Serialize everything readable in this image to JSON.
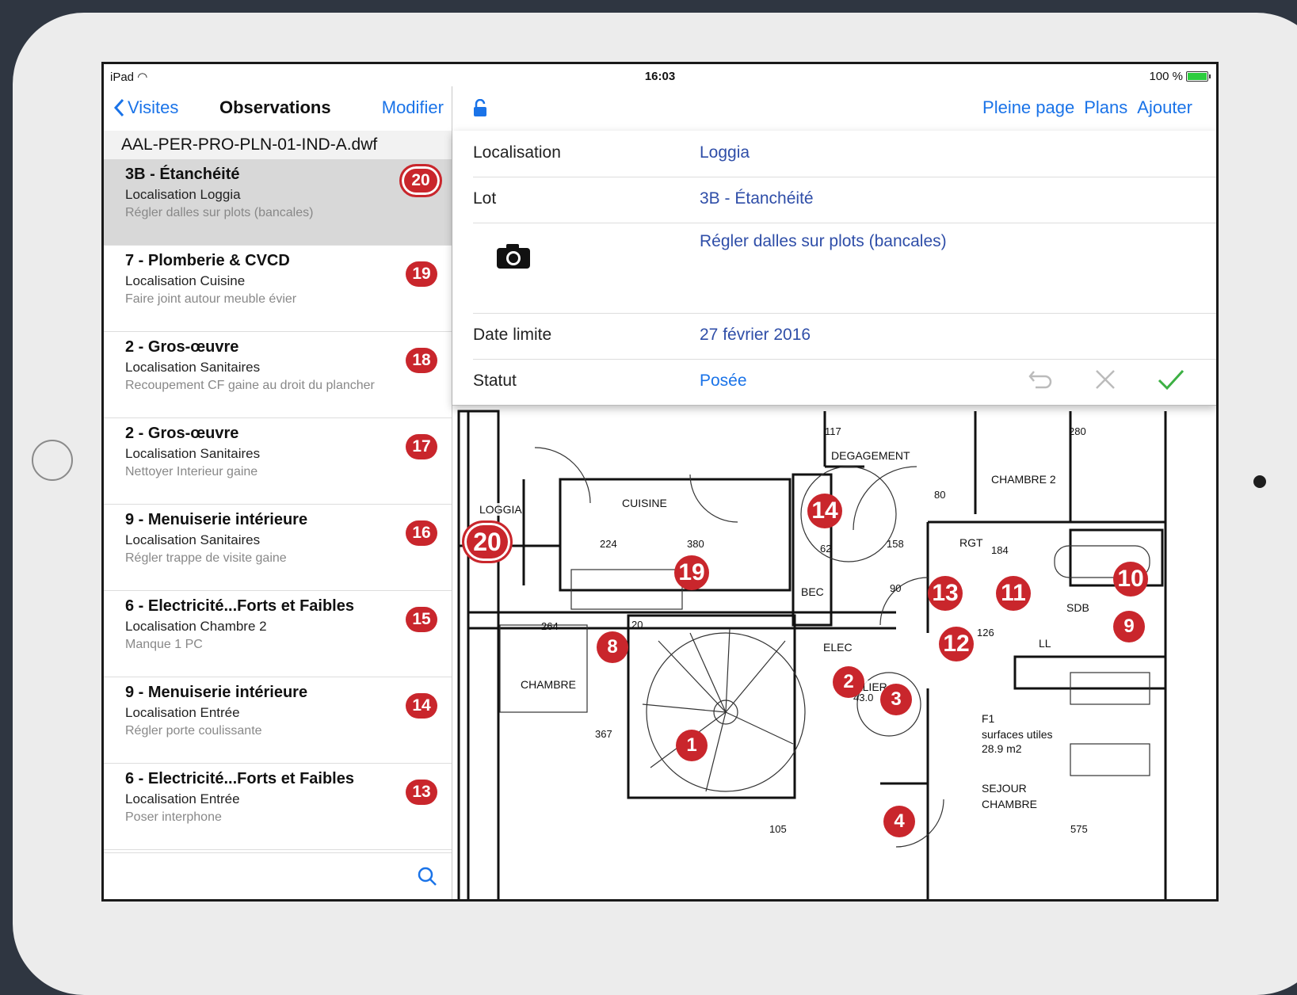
{
  "status_bar": {
    "device": "iPad",
    "time": "16:03",
    "battery": "100 %"
  },
  "left_nav": {
    "back_label": "Visites",
    "title": "Observations",
    "edit_label": "Modifier"
  },
  "file_name": "AAL-PER-PRO-PLN-01-IND-A.dwf",
  "observations": [
    {
      "title": "3B - Étanchéité",
      "location": "Localisation Loggia",
      "description": "Régler dalles sur plots (bancales)",
      "number": "20"
    },
    {
      "title": "7 - Plomberie & CVCD",
      "location": "Localisation Cuisine",
      "description": "Faire joint autour meuble évier",
      "number": "19"
    },
    {
      "title": "2 - Gros-œuvre",
      "location": "Localisation Sanitaires",
      "description": "Recoupement CF gaine au droit du plancher",
      "number": "18"
    },
    {
      "title": "2 - Gros-œuvre",
      "location": "Localisation Sanitaires",
      "description": "Nettoyer Interieur gaine",
      "number": "17"
    },
    {
      "title": "9 - Menuiserie intérieure",
      "location": "Localisation Sanitaires",
      "description": "Régler trappe de visite gaine",
      "number": "16"
    },
    {
      "title": "6 - Electricité...Forts et Faibles",
      "location": "Localisation Chambre 2",
      "description": "Manque 1 PC",
      "number": "15"
    },
    {
      "title": "9 - Menuiserie intérieure",
      "location": "Localisation Entrée",
      "description": "Régler porte coulissante",
      "number": "14"
    },
    {
      "title": "6 - Electricité...Forts et Faibles",
      "location": "Localisation Entrée",
      "description": "Poser interphone",
      "number": "13"
    }
  ],
  "right_nav": {
    "fullpage_label": "Pleine page",
    "plans_label": "Plans",
    "add_label": "Ajouter"
  },
  "detail": {
    "localisation_label": "Localisation",
    "localisation_value": "Loggia",
    "lot_label": "Lot",
    "lot_value": "3B - Étanchéité",
    "description_value": "Régler dalles sur plots (bancales)",
    "date_label": "Date limite",
    "date_value": "27 février 2016",
    "statut_label": "Statut",
    "statut_value": "Posée"
  },
  "plan": {
    "rooms": [
      "DEGAGEMENT",
      "CHAMBRE 2",
      "CUISINE",
      "LOGGIA",
      "RGT",
      "BEC",
      "SDB",
      "LL",
      "CHAMBRE",
      "PALIER",
      "ELEC",
      "F1",
      "surfaces utiles",
      "28.9 m2",
      "SEJOUR",
      "CHAMBRE"
    ],
    "dimensions": [
      "117",
      "280",
      "80",
      "380",
      "224",
      "62",
      "158",
      "184",
      "264",
      "20",
      "126",
      "90",
      "367",
      "105",
      "575",
      "43.0"
    ],
    "pins": [
      "20",
      "19",
      "14",
      "13",
      "11",
      "10",
      "9",
      "12",
      "8",
      "2",
      "3",
      "1",
      "4"
    ]
  },
  "colors": {
    "accent": "#1a73e8",
    "badge": "#c9262c",
    "value": "#2f4ea8",
    "confirm": "#3cb043"
  }
}
